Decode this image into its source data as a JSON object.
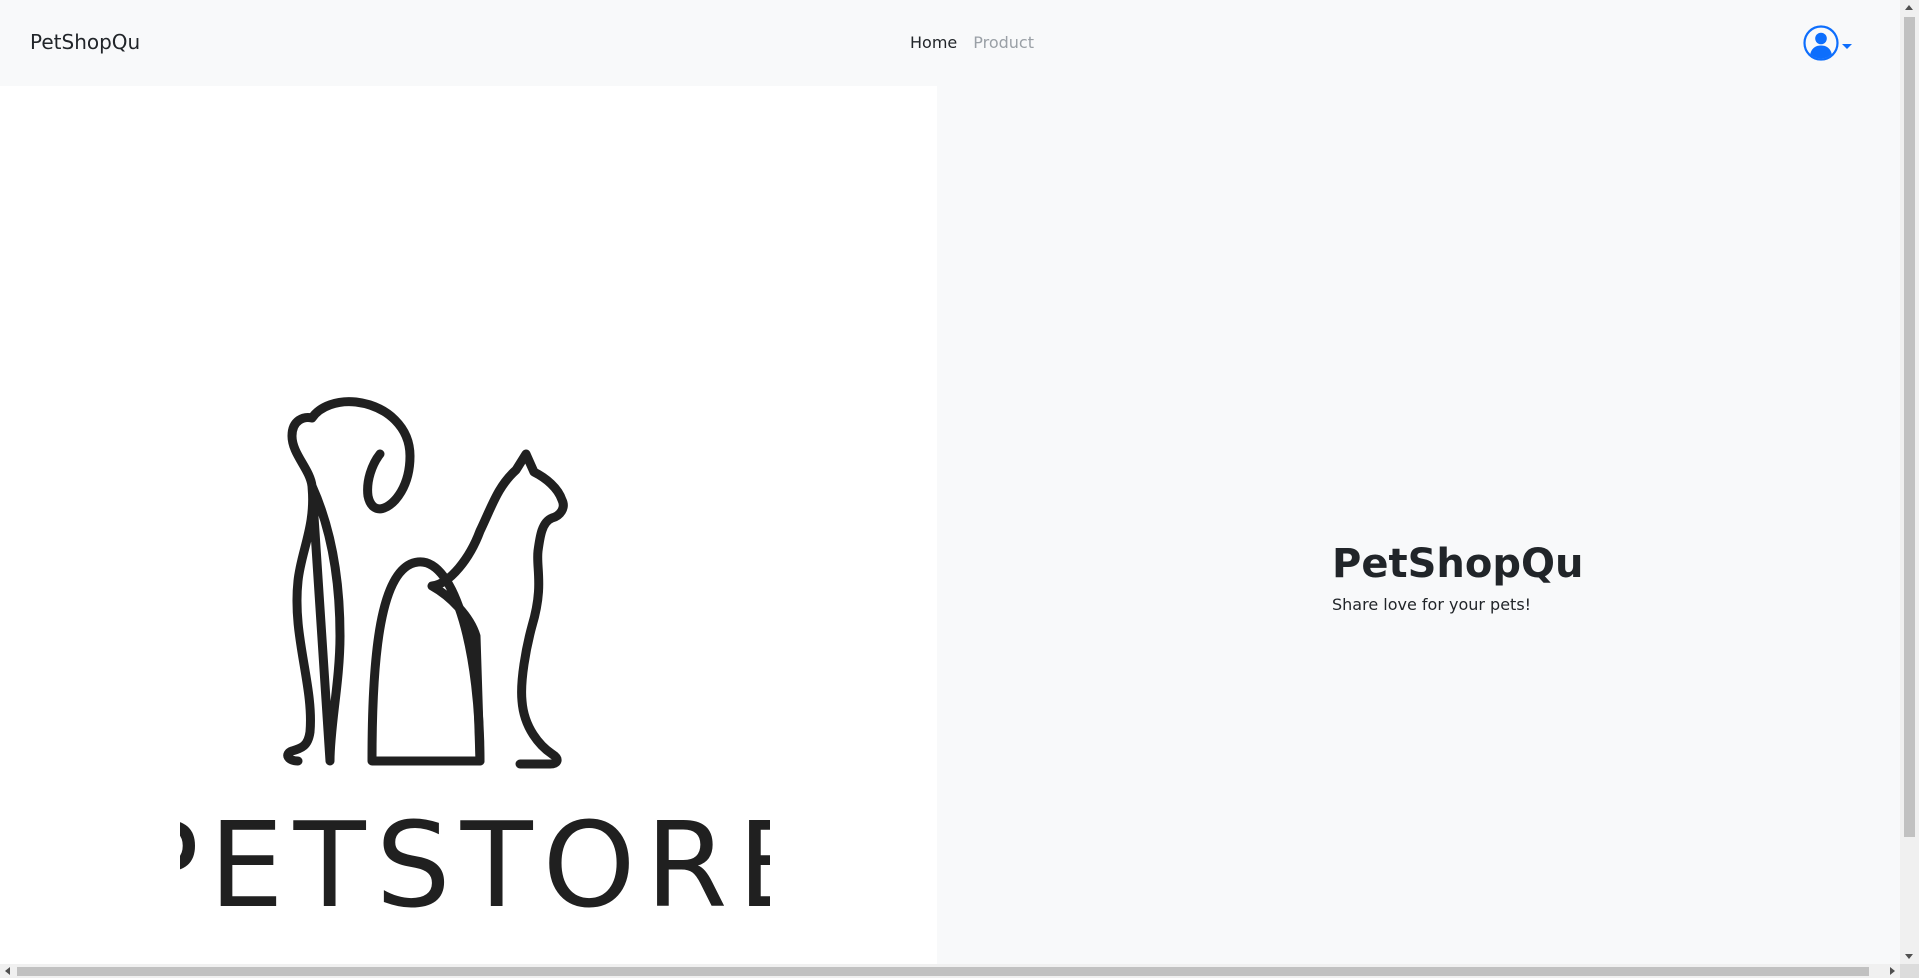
{
  "navbar": {
    "brand": "PetShopQu",
    "links": [
      {
        "label": "Home",
        "state": "active"
      },
      {
        "label": "Product",
        "state": "muted"
      }
    ],
    "user_icon": "user-circle-icon",
    "caret_icon": "caret-down-icon"
  },
  "hero": {
    "logo_text": "PETSTORE",
    "title": "PetShopQu",
    "subtitle": "Share love for your pets!"
  },
  "colors": {
    "accent": "#0d6efd",
    "navbar_bg": "#f8f9fa",
    "text": "#212529",
    "muted_link": "#9aa0a6"
  }
}
